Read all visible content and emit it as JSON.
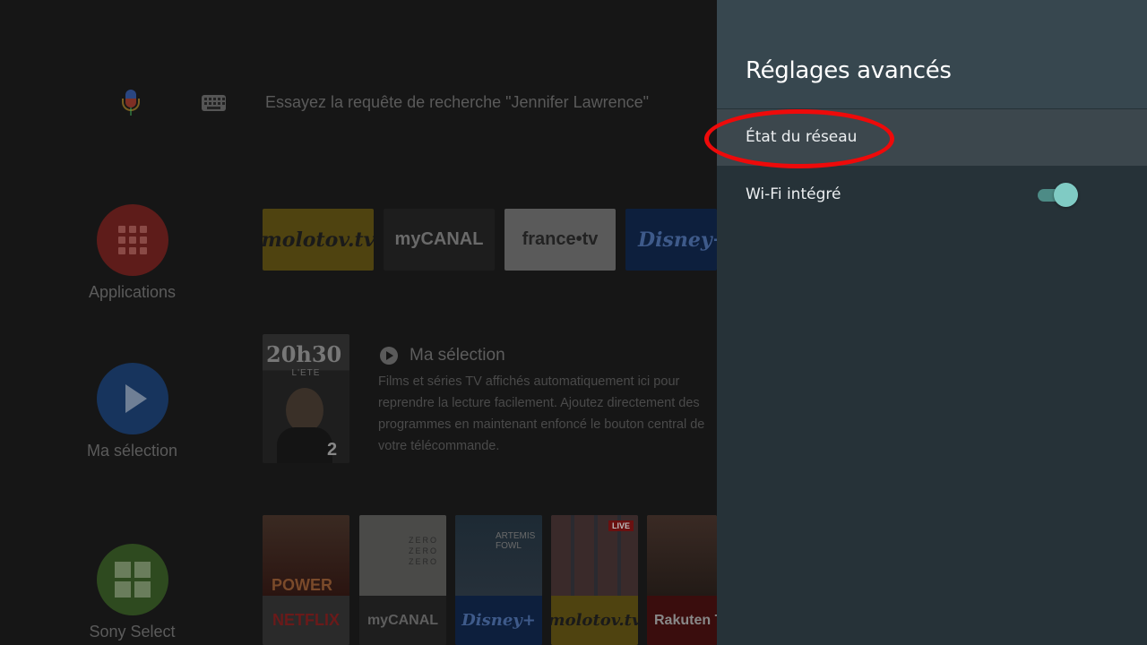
{
  "home": {
    "search_hint": "Essayez la requête de recherche \"Jennifer Lawrence\"",
    "sidebar": [
      {
        "label": "Applications",
        "icon": "apps-grid-icon"
      },
      {
        "label": "Ma sélection",
        "icon": "play-icon"
      },
      {
        "label": "Sony Select",
        "icon": "sony-select-icon"
      }
    ],
    "apps": [
      "molotov.tv",
      "myCANAL",
      "france•tv",
      "Disney+"
    ],
    "poster": {
      "title": "20h30",
      "subtitle": "L'ETE",
      "channel": "2"
    },
    "selection": {
      "title": "Ma sélection",
      "desc_lines": [
        "Films et séries TV affichés automatiquement ici pour",
        "reprendre la lecture facilement. Ajoutez directement des",
        "programmes en maintenant enfoncé le bouton central de",
        "votre télécommande."
      ]
    },
    "thumbs": [
      {
        "art": "POWER",
        "label": "NETFLIX"
      },
      {
        "art": "ZERO ZERO ZERO",
        "label": "myCANAL"
      },
      {
        "art": "ARTEMIS FOWL",
        "label": "Disney+"
      },
      {
        "art": "LIVE",
        "label": "molotov.tv"
      },
      {
        "art": "",
        "label": "Rakuten TV"
      }
    ]
  },
  "settings": {
    "title": "Réglages avancés",
    "items": [
      {
        "label": "État du réseau",
        "focused": true
      },
      {
        "label": "Wi-Fi intégré",
        "toggle_on": true
      }
    ]
  },
  "colors": {
    "panel_bg": "#263238",
    "panel_header": "#37474f",
    "toggle_accent": "#80cbc4",
    "annotation": "#ee0a0a"
  }
}
